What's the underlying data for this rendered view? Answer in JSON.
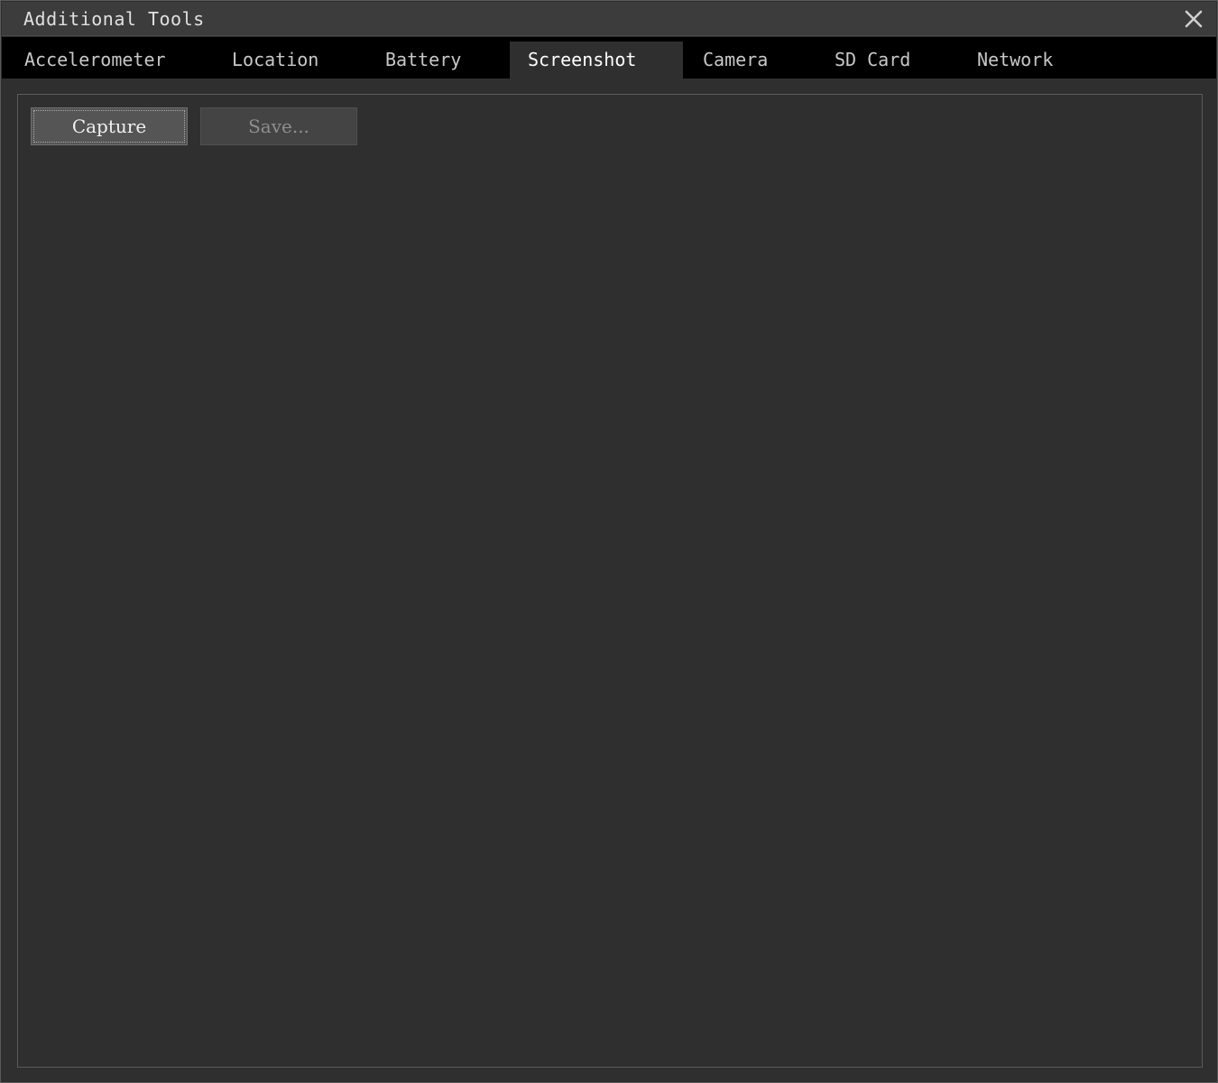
{
  "window": {
    "title": "Additional Tools"
  },
  "tabs": [
    {
      "label": "Accelerometer",
      "active": false
    },
    {
      "label": "Location",
      "active": false
    },
    {
      "label": "Battery",
      "active": false
    },
    {
      "label": "Screenshot",
      "active": true
    },
    {
      "label": "Camera",
      "active": false
    },
    {
      "label": "SD Card",
      "active": false
    },
    {
      "label": "Network",
      "active": false
    }
  ],
  "screenshot_panel": {
    "capture_label": "Capture",
    "save_label": "Save...",
    "save_enabled": false
  },
  "icons": {
    "close": "close-icon"
  },
  "colors": {
    "window_bg": "#2f2f2f",
    "titlebar_bg": "#3c3c3c",
    "tabbar_bg": "#000000",
    "text": "#e0e0e0",
    "disabled_text": "#8e8e8e"
  }
}
